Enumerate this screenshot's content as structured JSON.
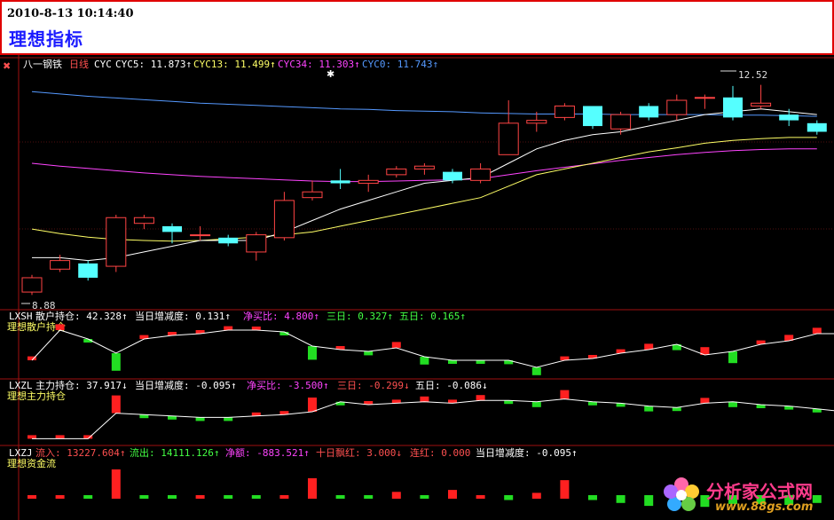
{
  "header": {
    "datetime": "2010-8-13 10:14:40",
    "title": "理想指标"
  },
  "panel_main": {
    "stock": "八一钢铁",
    "period": "日线",
    "indicator": "CYC",
    "cyc5": "CYC5: 11.873↑",
    "cyc13": "CYC13: 11.499↑",
    "cyc34": "CYC34: 11.303↑",
    "cyc0": "CYC0: 11.743↑",
    "high_label": "12.52",
    "low_label": "8.88",
    "colors": {
      "cyc5": "#ffffff",
      "cyc13": "#ffff66",
      "cyc34": "#ff44ff",
      "cyc0": "#5599ff",
      "up": "#ff4444",
      "down": "#55ffff"
    }
  },
  "panel_lxsh": {
    "code": "LXSH",
    "name": "理想散户持仓",
    "hold": "散户持仓: 42.328↑",
    "change": "当日增减度: 0.131↑",
    "ratio": "净买比: 4.800↑",
    "d3": "三日: 0.327↑",
    "d5": "五日: 0.165↑"
  },
  "panel_lxzl": {
    "code": "LXZL",
    "name": "理想主力持仓",
    "hold": "主力持仓: 37.917↓",
    "change": "当日增减度: -0.095↑",
    "ratio": "净买比: -3.500↑",
    "d3": "三日: -0.299↓",
    "d5": "五日: -0.086↓"
  },
  "panel_lxzj": {
    "code": "LXZJ",
    "name": "理想资金流",
    "inflow": "流入: 13227.604↑",
    "outflow": "流出: 14111.126↑",
    "net": "净额: -883.521↑",
    "red10": "十日飘红: 3.000↓",
    "consec": "连红: 0.000",
    "change": "当日增减度: -0.095↑"
  },
  "logo": {
    "name": "分析家公式网",
    "url": "www.88gs.com"
  },
  "chart_data": {
    "type": "candlestick",
    "candles": [
      {
        "o": 8.9,
        "c": 9.15,
        "h": 9.2,
        "l": 8.85
      },
      {
        "o": 9.3,
        "c": 9.45,
        "h": 9.55,
        "l": 9.25
      },
      {
        "o": 9.4,
        "c": 9.15,
        "h": 9.45,
        "l": 9.1
      },
      {
        "o": 9.35,
        "c": 10.2,
        "h": 10.25,
        "l": 9.25
      },
      {
        "o": 10.1,
        "c": 10.2,
        "h": 10.25,
        "l": 10.0
      },
      {
        "o": 10.05,
        "c": 9.95,
        "h": 10.1,
        "l": 9.75
      },
      {
        "o": 9.9,
        "c": 9.9,
        "h": 10.05,
        "l": 9.8
      },
      {
        "o": 9.85,
        "c": 9.75,
        "h": 9.9,
        "l": 9.7
      },
      {
        "o": 9.6,
        "c": 9.9,
        "h": 9.95,
        "l": 9.45
      },
      {
        "o": 9.85,
        "c": 10.5,
        "h": 10.65,
        "l": 9.8
      },
      {
        "o": 10.55,
        "c": 10.65,
        "h": 10.85,
        "l": 10.5
      },
      {
        "o": 10.85,
        "c": 10.8,
        "h": 11.05,
        "l": 10.7
      },
      {
        "o": 10.8,
        "c": 10.85,
        "h": 10.95,
        "l": 10.65
      },
      {
        "o": 10.95,
        "c": 11.05,
        "h": 11.1,
        "l": 10.9
      },
      {
        "o": 11.05,
        "c": 11.1,
        "h": 11.15,
        "l": 10.95
      },
      {
        "o": 11.0,
        "c": 10.85,
        "h": 11.05,
        "l": 10.8
      },
      {
        "o": 10.85,
        "c": 11.05,
        "h": 11.15,
        "l": 10.8
      },
      {
        "o": 11.3,
        "c": 11.85,
        "h": 12.25,
        "l": 11.3
      },
      {
        "o": 11.85,
        "c": 11.9,
        "h": 12.05,
        "l": 11.7
      },
      {
        "o": 11.95,
        "c": 12.15,
        "h": 12.2,
        "l": 11.9
      },
      {
        "o": 12.15,
        "c": 11.8,
        "h": 12.15,
        "l": 11.75
      },
      {
        "o": 11.75,
        "c": 12.0,
        "h": 12.05,
        "l": 11.65
      },
      {
        "o": 12.15,
        "c": 11.95,
        "h": 12.2,
        "l": 11.9
      },
      {
        "o": 12.0,
        "c": 12.25,
        "h": 12.35,
        "l": 11.9
      },
      {
        "o": 12.3,
        "c": 12.3,
        "h": 12.35,
        "l": 12.1
      },
      {
        "o": 12.3,
        "c": 11.95,
        "h": 12.5,
        "l": 11.9
      },
      {
        "o": 12.15,
        "c": 12.2,
        "h": 12.52,
        "l": 12.1
      },
      {
        "o": 12.0,
        "c": 11.9,
        "h": 12.1,
        "l": 11.8
      },
      {
        "o": 11.85,
        "c": 11.7,
        "h": 11.9,
        "l": 11.65
      }
    ],
    "cyc5": [
      9.5,
      9.5,
      9.45,
      9.5,
      9.6,
      9.7,
      9.8,
      9.8,
      9.8,
      9.95,
      10.15,
      10.35,
      10.5,
      10.65,
      10.8,
      10.85,
      10.9,
      11.15,
      11.4,
      11.55,
      11.65,
      11.7,
      11.8,
      11.9,
      12.0,
      12.05,
      12.1,
      12.05,
      12.0
    ],
    "cyc13": [
      10.0,
      9.92,
      9.86,
      9.82,
      9.8,
      9.79,
      9.8,
      9.83,
      9.86,
      9.9,
      9.95,
      10.05,
      10.15,
      10.25,
      10.35,
      10.45,
      10.55,
      10.75,
      10.95,
      11.05,
      11.15,
      11.25,
      11.35,
      11.42,
      11.5,
      11.55,
      11.58,
      11.6,
      11.6
    ],
    "cyc34": [
      11.15,
      11.1,
      11.06,
      11.02,
      10.98,
      10.95,
      10.92,
      10.9,
      10.88,
      10.86,
      10.84,
      10.83,
      10.83,
      10.84,
      10.85,
      10.86,
      10.88,
      10.95,
      11.02,
      11.08,
      11.14,
      11.2,
      11.25,
      11.3,
      11.34,
      11.37,
      11.39,
      11.4,
      11.4
    ],
    "cyc0": [
      12.4,
      12.36,
      12.32,
      12.29,
      12.26,
      12.23,
      12.2,
      12.18,
      12.16,
      12.14,
      12.12,
      12.1,
      12.09,
      12.07,
      12.06,
      12.05,
      12.03,
      12.02,
      12.01,
      12.01,
      12.01,
      12.0,
      12.0,
      12.0,
      12.0,
      11.99,
      11.99,
      11.98,
      11.97
    ],
    "lxsh_line": [
      40.8,
      42.5,
      42.0,
      41.2,
      42.0,
      42.2,
      42.3,
      42.5,
      42.5,
      42.4,
      41.6,
      41.4,
      41.3,
      41.5,
      41.0,
      40.8,
      40.8,
      40.8,
      40.4,
      40.8,
      40.9,
      41.2,
      41.4,
      41.7,
      41.1,
      41.3,
      41.7,
      41.9,
      42.3,
      42.3
    ],
    "lxsh_bars": [
      0.2,
      0.3,
      -0.1,
      -0.9,
      0.2,
      0.1,
      0.1,
      0.2,
      0.1,
      -0.1,
      -0.7,
      0.1,
      -0.2,
      0.3,
      -0.4,
      -0.1,
      -0.1,
      -0.2,
      -0.4,
      0.2,
      0.1,
      0.2,
      0.3,
      -0.3,
      0.4,
      -0.6,
      0.2,
      0.3,
      0.3,
      0.3
    ],
    "lxzl_line": [
      36.0,
      36.0,
      36.0,
      37.8,
      37.7,
      37.6,
      37.5,
      37.5,
      37.6,
      37.7,
      37.9,
      38.6,
      38.4,
      38.5,
      38.6,
      38.5,
      38.7,
      38.7,
      38.6,
      38.8,
      38.6,
      38.5,
      38.3,
      38.2,
      38.5,
      38.6,
      38.4,
      38.3,
      38.1,
      37.9
    ],
    "lxzl_bars": [
      0.05,
      0.2,
      0.1,
      1.0,
      -0.1,
      -0.1,
      -0.15,
      -0.1,
      0.1,
      0.2,
      0.8,
      -0.1,
      0.2,
      0.2,
      0.3,
      0.1,
      0.3,
      -0.2,
      -0.3,
      0.5,
      -0.2,
      -0.1,
      -0.3,
      -0.2,
      0.3,
      -0.3,
      -0.2,
      -0.2,
      -0.2,
      -0.1
    ],
    "lxzj_bars": [
      0.2,
      0.3,
      -0.1,
      3.0,
      -0.2,
      -0.1,
      0.1,
      -0.2,
      -0.1,
      0.2,
      2.1,
      -0.2,
      -0.1,
      0.7,
      -0.3,
      0.9,
      0.3,
      -0.5,
      0.6,
      1.9,
      -0.5,
      -0.8,
      -1.1,
      0.4,
      -1.2,
      -0.9,
      -0.9,
      -1.0,
      -0.8,
      -0.5
    ]
  }
}
